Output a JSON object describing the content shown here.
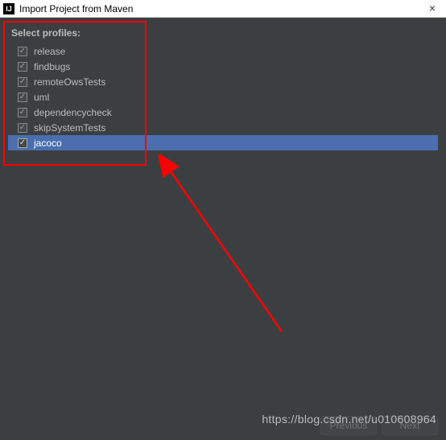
{
  "window": {
    "title": "Import Project from Maven",
    "icon_letter": "IJ"
  },
  "section": {
    "label": "Select profiles:"
  },
  "profiles": [
    {
      "name": "release",
      "checked": true,
      "selected": false
    },
    {
      "name": "findbugs",
      "checked": true,
      "selected": false
    },
    {
      "name": "remoteOwsTests",
      "checked": true,
      "selected": false
    },
    {
      "name": "uml",
      "checked": true,
      "selected": false
    },
    {
      "name": "dependencycheck",
      "checked": true,
      "selected": false
    },
    {
      "name": "skipSystemTests",
      "checked": true,
      "selected": false
    },
    {
      "name": "jacoco",
      "checked": true,
      "selected": true
    }
  ],
  "buttons": {
    "previous": "Previous",
    "next": "Next"
  },
  "watermark": "https://blog.csdn.net/u010608964",
  "annotation": {
    "highlight_color": "#ff0000"
  }
}
